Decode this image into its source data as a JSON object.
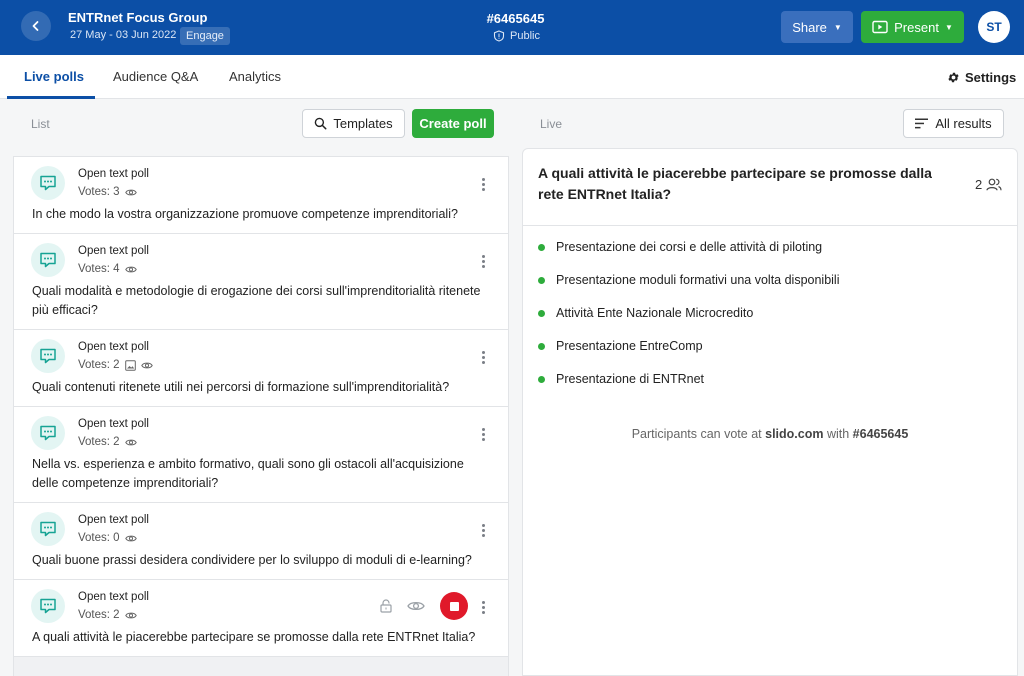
{
  "header": {
    "event_title": "ENTRnet Focus Group",
    "dates": "27 May - 03 Jun 2022",
    "mode_badge": "Engage",
    "event_code": "#6465645",
    "visibility": "Public",
    "share_label": "Share",
    "present_label": "Present",
    "avatar_initials": "ST"
  },
  "tabs": [
    {
      "label": "Live polls",
      "active": true
    },
    {
      "label": "Audience Q&A",
      "active": false
    },
    {
      "label": "Analytics",
      "active": false
    }
  ],
  "settings_label": "Settings",
  "toolbar": {
    "list_label": "List",
    "templates_label": "Templates",
    "create_label": "Create poll",
    "live_label": "Live",
    "all_results_label": "All results"
  },
  "polls": [
    {
      "type": "Open text poll",
      "votes": "Votes: 3",
      "question": "In che modo la vostra organizzazione promuove competenze imprenditoriali?"
    },
    {
      "type": "Open text poll",
      "votes": "Votes: 4",
      "question": "Quali modalità e metodologie di erogazione dei corsi sull'imprenditorialità ritenete più efficaci?"
    },
    {
      "type": "Open text poll",
      "votes": "Votes: 2",
      "question": "Quali contenuti ritenete utili nei percorsi di formazione sull'imprenditorialità?"
    },
    {
      "type": "Open text poll",
      "votes": "Votes: 2",
      "question": "Nella vs. esperienza e ambito formativo, quali sono gli ostacoli all'acquisizione delle competenze imprenditoriali?"
    },
    {
      "type": "Open text poll",
      "votes": "Votes: 0",
      "question": "Quali buone prassi desidera condividere per lo sviluppo di moduli di e-learning?"
    },
    {
      "type": "Open text poll",
      "votes": "Votes: 2",
      "question": "A quali attività le piacerebbe partecipare se promosse dalla rete ENTRnet Italia?"
    }
  ],
  "live": {
    "title": "A quali attività le piacerebbe partecipare se promosse dalla rete ENTRnet Italia?",
    "participants": "2",
    "options": [
      "Presentazione dei corsi e delle attività di piloting",
      "Presentazione moduli formativi una volta disponibili",
      "Attività Ente Nazionale Microcredito",
      "Presentazione EntreComp",
      "Presentazione di ENTRnet"
    ],
    "vote_note_prefix": "Participants can vote at",
    "vote_note_site": "slido.com",
    "vote_note_mid": "with",
    "vote_note_code": "#6465645"
  },
  "colors": {
    "header_blue": "#0c4fa6",
    "green": "#2eac3c",
    "stop_red": "#e0192a"
  }
}
